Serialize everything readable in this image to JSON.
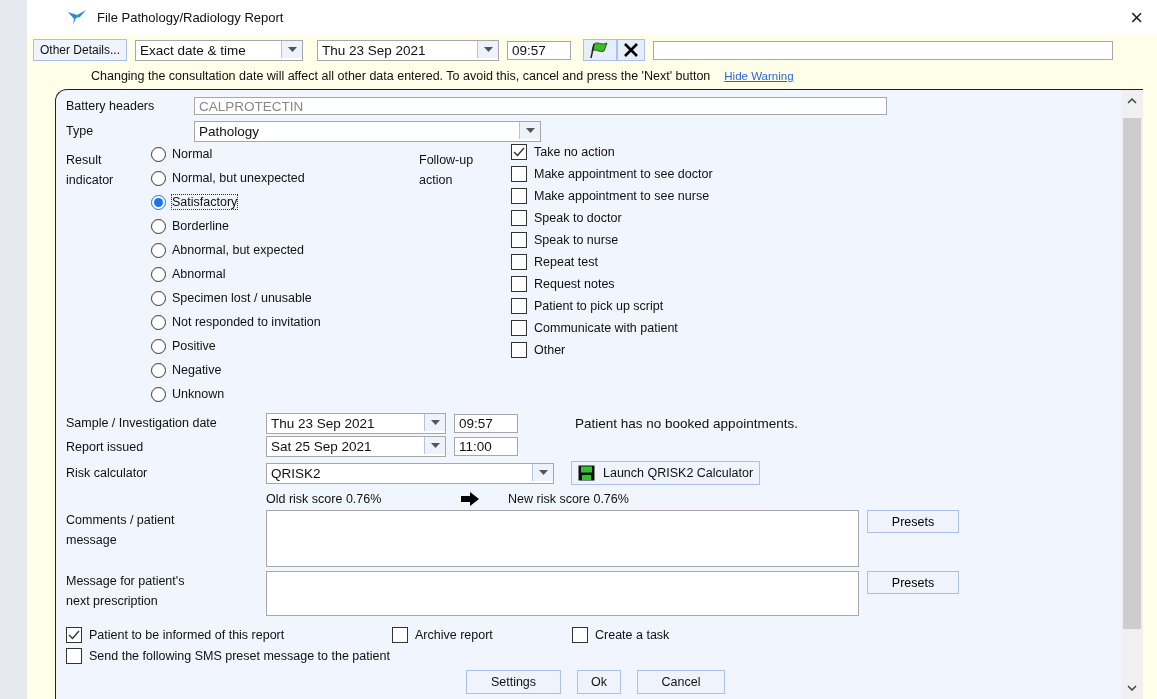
{
  "window": {
    "title": "File Pathology/Radiology Report",
    "close": "×"
  },
  "toolbar": {
    "other_details": "Other Details...",
    "date_mode": "Exact date & time",
    "date": "Thu 23 Sep 2021",
    "time": "09:57"
  },
  "warning": {
    "text": "Changing the consultation date will affect all other data entered. To avoid this, cancel and press the 'Next' button",
    "hide_link": "Hide Warning"
  },
  "form": {
    "battery_headers": {
      "label": "Battery headers",
      "value": "CALPROTECTIN"
    },
    "type": {
      "label": "Type",
      "value": "Pathology"
    },
    "result_indicator": {
      "label": "Result indicator",
      "options": [
        {
          "label": "Normal",
          "selected": false
        },
        {
          "label": "Normal, but unexpected",
          "selected": false
        },
        {
          "label": "Satisfactory",
          "selected": true
        },
        {
          "label": "Borderline",
          "selected": false
        },
        {
          "label": "Abnormal, but expected",
          "selected": false
        },
        {
          "label": "Abnormal",
          "selected": false
        },
        {
          "label": "Specimen lost / unusable",
          "selected": false
        },
        {
          "label": "Not responded to invitation",
          "selected": false
        },
        {
          "label": "Positive",
          "selected": false
        },
        {
          "label": "Negative",
          "selected": false
        },
        {
          "label": "Unknown",
          "selected": false
        }
      ]
    },
    "follow_up": {
      "label": "Follow-up action",
      "options": [
        {
          "label": "Take no action",
          "checked": true
        },
        {
          "label": "Make appointment to see doctor",
          "checked": false
        },
        {
          "label": "Make appointment to see nurse",
          "checked": false
        },
        {
          "label": "Speak to doctor",
          "checked": false
        },
        {
          "label": "Speak to nurse",
          "checked": false
        },
        {
          "label": "Repeat test",
          "checked": false
        },
        {
          "label": "Request notes",
          "checked": false
        },
        {
          "label": "Patient to pick up script",
          "checked": false
        },
        {
          "label": "Communicate with patient",
          "checked": false
        },
        {
          "label": "Other",
          "checked": false
        }
      ]
    },
    "sample_date": {
      "label": "Sample / Investigation date",
      "date": "Thu 23 Sep 2021",
      "time": "09:57"
    },
    "appointments_note": "Patient has no booked appointments.",
    "report_issued": {
      "label": "Report issued",
      "date": "Sat 25 Sep 2021",
      "time": "11:00"
    },
    "risk_calculator": {
      "label": "Risk calculator",
      "value": "QRISK2",
      "launch_button": "Launch QRISK2 Calculator"
    },
    "old_risk": "Old risk score 0.76%",
    "new_risk": "New risk score 0.76%",
    "comments": {
      "label": "Comments / patient message",
      "presets": "Presets"
    },
    "next_prescription": {
      "label": "Message for patient's next prescription",
      "presets": "Presets"
    },
    "bottom_checks": [
      {
        "label": "Patient to be informed of this report",
        "checked": true
      },
      {
        "label": "Archive report",
        "checked": false
      },
      {
        "label": "Create a task",
        "checked": false
      }
    ],
    "sms": {
      "label": "Send the following SMS preset message to the patient",
      "checked": false
    }
  },
  "buttons": [
    "Settings",
    "Ok",
    "Cancel"
  ]
}
